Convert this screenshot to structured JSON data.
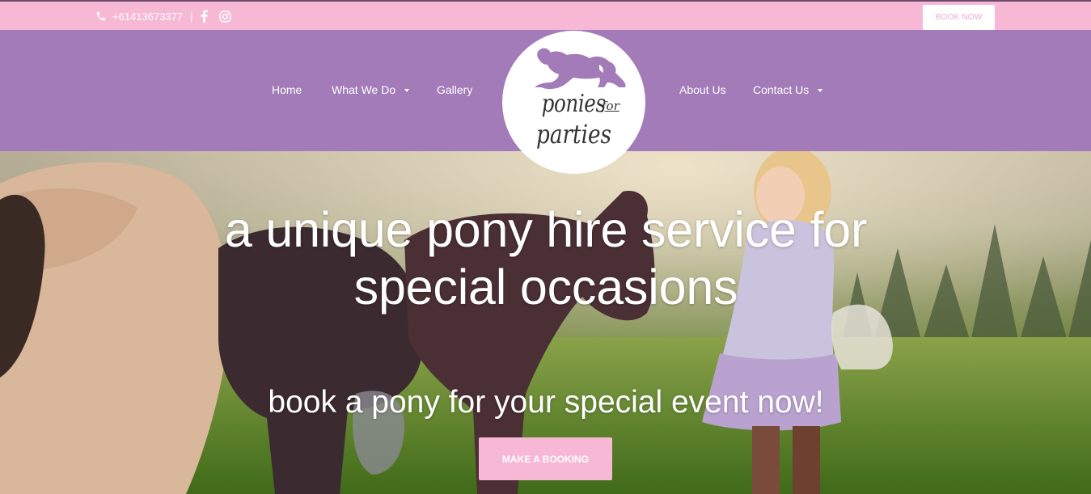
{
  "topbar": {
    "phone": "+61413673377",
    "separator": "|",
    "book_now_label": "BOOK NOW"
  },
  "nav": {
    "left": [
      {
        "label": "Home"
      },
      {
        "label": "What We Do",
        "dropdown": true
      },
      {
        "label": "Gallery"
      }
    ],
    "right": [
      {
        "label": "About Us"
      },
      {
        "label": "Contact Us",
        "dropdown": true
      }
    ]
  },
  "logo": {
    "word1": "ponies",
    "word_for": "for",
    "word2": "parties"
  },
  "hero": {
    "headline": "a unique pony hire service for special occasions",
    "subline": "book a pony for your special event now!",
    "cta_label": "MAKE A BOOKING"
  },
  "colors": {
    "topbar": "#f7b8d6",
    "nav": "#a37bb9",
    "accent_pink": "#f7b8d6",
    "logo_purple": "#a37bb9"
  },
  "icons": [
    "phone-icon",
    "facebook-icon",
    "instagram-icon",
    "chevron-down-icon",
    "pony-logo-icon"
  ]
}
